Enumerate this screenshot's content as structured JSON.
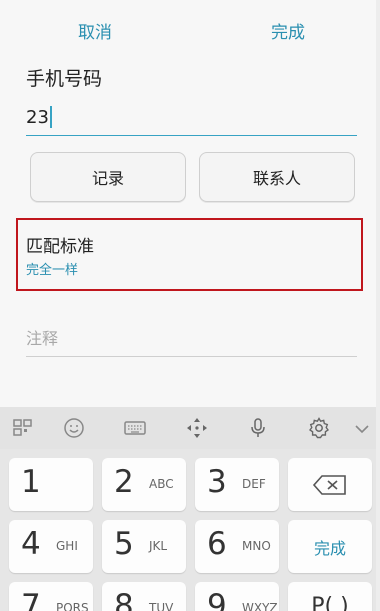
{
  "topbar": {
    "cancel_label": "取消",
    "done_label": "完成"
  },
  "phone": {
    "label": "手机号码",
    "value": "23"
  },
  "buttons": {
    "record_label": "记录",
    "contacts_label": "联系人"
  },
  "match": {
    "title": "匹配标准",
    "value": "完全一样"
  },
  "note": {
    "placeholder": "注释"
  },
  "keyboard": {
    "toolbar_icons": [
      "apps-grid-icon",
      "emoji-icon",
      "keyboard-icon",
      "move-arrows-icon",
      "mic-icon",
      "gear-icon",
      "chevron-down-icon"
    ],
    "keys": [
      {
        "num": "1",
        "letters": ""
      },
      {
        "num": "2",
        "letters": "ABC"
      },
      {
        "num": "3",
        "letters": "DEF"
      },
      {
        "num": "4",
        "letters": "GHI"
      },
      {
        "num": "5",
        "letters": "JKL"
      },
      {
        "num": "6",
        "letters": "MNO"
      },
      {
        "num": "7",
        "letters": "PQRS"
      },
      {
        "num": "8",
        "letters": "TUV"
      },
      {
        "num": "9",
        "letters": "WXYZ"
      }
    ],
    "done_label": "完成",
    "paren_label": "P( )"
  },
  "colors": {
    "accent": "#2a8fb0",
    "highlight_border": "#c0161d"
  }
}
